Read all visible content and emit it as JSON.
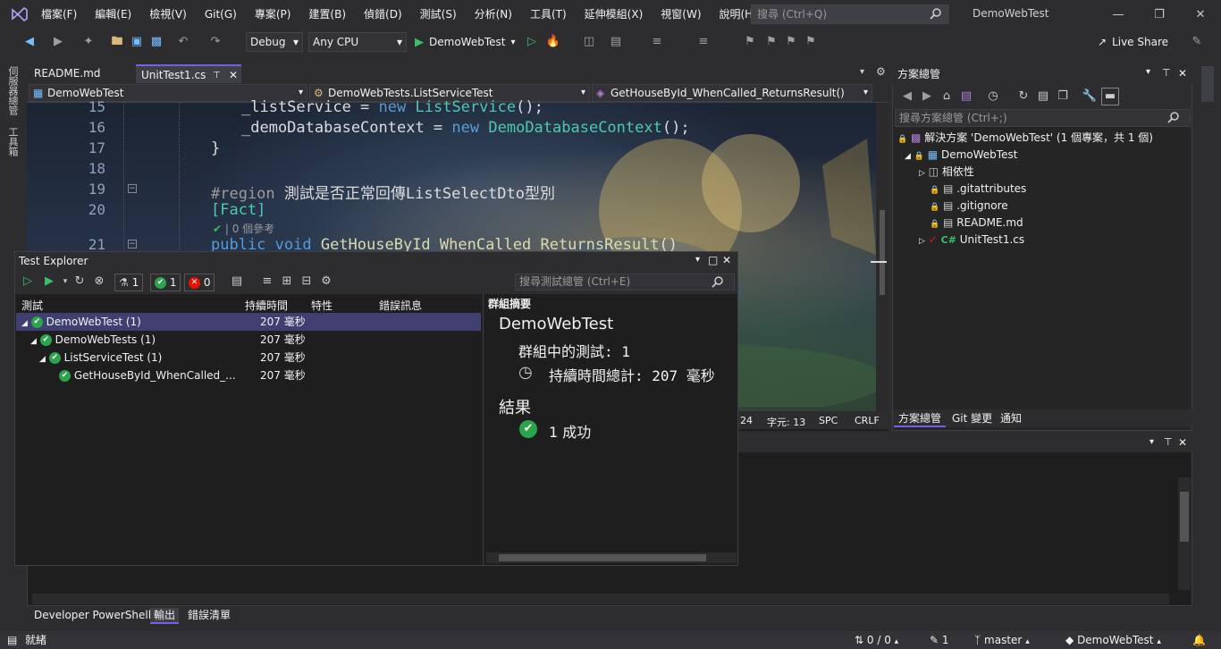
{
  "menu": [
    "檔案(F)",
    "編輯(E)",
    "檢視(V)",
    "Git(G)",
    "專案(P)",
    "建置(B)",
    "偵錯(D)",
    "測試(S)",
    "分析(N)",
    "工具(T)",
    "延伸模組(X)",
    "視窗(W)",
    "說明(H)"
  ],
  "search_placeholder": "搜尋 (Ctrl+Q)",
  "app_name": "DemoWebTest",
  "toolbar": {
    "config": "Debug",
    "platform": "Any CPU",
    "run_target": "DemoWebTest",
    "live_share": "Live Share"
  },
  "left_rail": [
    "伺服器總管",
    "工具箱"
  ],
  "doc_tabs": [
    {
      "label": "README.md"
    },
    {
      "label": "UnitTest1.cs"
    }
  ],
  "nav": {
    "project": "DemoWebTest",
    "class": "DemoWebTests.ListServiceTest",
    "member": "GetHouseById_WhenCalled_ReturnsResult()"
  },
  "code": {
    "line_numbers": [
      "15",
      "16",
      "17",
      "18",
      "19",
      "20",
      "21"
    ],
    "l15_a": "_listService = ",
    "l15_kw": "new",
    "l15_ty": "ListService",
    "l15_b": "();",
    "l16_a": "_demoDatabaseContext = ",
    "l16_kw": "new",
    "l16_ty": "DemoDatabaseContext",
    "l16_b": "();",
    "l17": "}",
    "l19_rg": "#region",
    "l19_text": " 測試是否正常回傳ListSelectDto型別",
    "l20": "[Fact]",
    "codelens": "0 個參考",
    "l21_kw": "public void",
    "l21_fn": "GetHouseById_WhenCalled_ReturnsResult",
    "l21_b": "()"
  },
  "editor_status": {
    "line": "24",
    "col": "字元: 13",
    "ws": "SPC",
    "eol": "CRLF"
  },
  "solution": {
    "title": "方案總管",
    "search_placeholder": "搜尋方案總管 (Ctrl+;)",
    "items": [
      "解決方案 'DemoWebTest' (1 個專案，共 1 個)",
      "DemoWebTest",
      "相依性",
      ".gitattributes",
      ".gitignore",
      "README.md",
      "UnitTest1.cs"
    ],
    "tabs": [
      "方案總管",
      "Git 變更",
      "通知"
    ]
  },
  "test_explorer": {
    "title": "Test Explorer",
    "counts": {
      "total": "1",
      "passed": "1",
      "failed": "0"
    },
    "search_placeholder": "搜尋測試總管 (Ctrl+E)",
    "columns": [
      "測試",
      "持續時間",
      "特性",
      "錯誤訊息"
    ],
    "rows": [
      {
        "name": "DemoWebTest (1)",
        "duration": "207 毫秒"
      },
      {
        "name": "DemoWebTests (1)",
        "duration": "207 毫秒"
      },
      {
        "name": "ListServiceTest (1)",
        "duration": "207 毫秒"
      },
      {
        "name": "GetHouseById_WhenCalled_...",
        "duration": "207 毫秒"
      }
    ],
    "summary": {
      "header": "群組摘要",
      "name": "DemoWebTest",
      "tests_in_group": "群組中的測試: 1",
      "total_duration": "持續時間總計: 207 毫秒",
      "results_label": "結果",
      "passed": "1 成功"
    }
  },
  "bottom_tabs": [
    "Developer PowerShell",
    "輸出",
    "錯誤清單"
  ],
  "status": {
    "ready": "就緒",
    "changes": "0 / 0",
    "commits": "1",
    "branch": "master",
    "repo": "DemoWebTest"
  },
  "colors": {
    "accent": "#3f3f72",
    "pass": "#2ca44e",
    "fail": "#e51400"
  }
}
